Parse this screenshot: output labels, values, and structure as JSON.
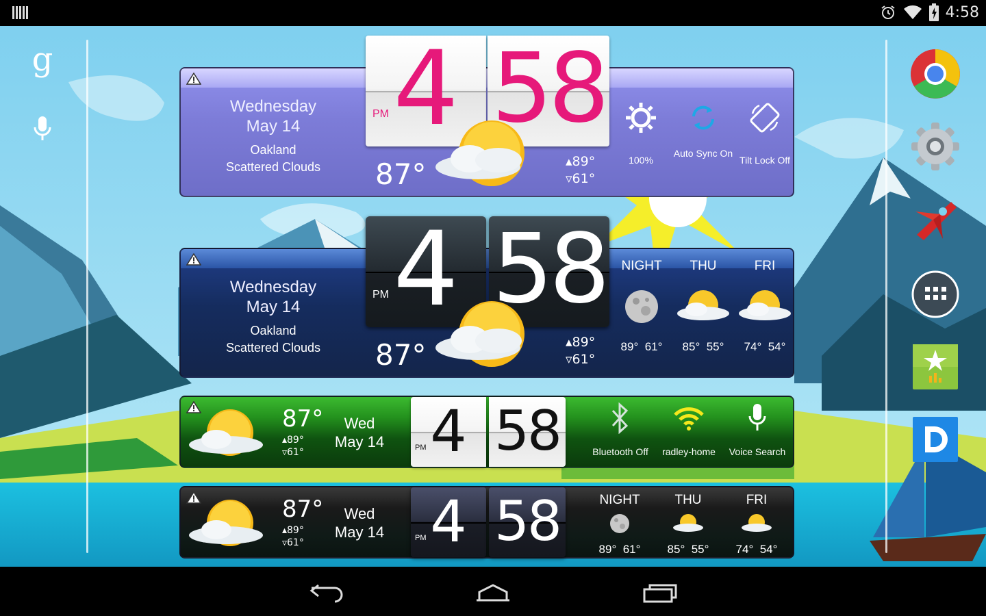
{
  "status_bar": {
    "time": "4:58"
  },
  "widgets": [
    {
      "style": "purple",
      "day": "Wednesday",
      "date": "May 14",
      "city": "Oakland",
      "condition": "Scattered Clouds",
      "hour": "4",
      "minute": "58",
      "ampm": "PM",
      "temp": "87°",
      "high": "▴89°",
      "low": "▿61°",
      "controls": [
        {
          "label": "100%",
          "icon": "brightness-icon"
        },
        {
          "label": "Auto Sync On",
          "icon": "sync-icon"
        },
        {
          "label": "Tilt Lock Off",
          "icon": "rotation-icon"
        }
      ]
    },
    {
      "style": "dark-blue",
      "day": "Wednesday",
      "date": "May 14",
      "city": "Oakland",
      "condition": "Scattered Clouds",
      "hour": "4",
      "minute": "58",
      "ampm": "PM",
      "temp": "87°",
      "high": "▴89°",
      "low": "▿61°",
      "forecast": [
        {
          "label": "NIGHT",
          "hi": "89°",
          "lo": "61°",
          "icon": "moon-icon"
        },
        {
          "label": "THU",
          "hi": "85°",
          "lo": "55°",
          "icon": "partly-cloudy-icon"
        },
        {
          "label": "FRI",
          "hi": "74°",
          "lo": "54°",
          "icon": "partly-cloudy-icon"
        }
      ]
    },
    {
      "style": "green",
      "temp": "87°",
      "high": "▴89°",
      "low": "▿61°",
      "day": "Wed",
      "date": "May 14",
      "hour": "4",
      "minute": "58",
      "ampm": "PM",
      "controls": [
        {
          "label": "Bluetooth Off",
          "icon": "bluetooth-icon"
        },
        {
          "label": "radley-home",
          "icon": "wifi-icon"
        },
        {
          "label": "Voice Search",
          "icon": "microphone-icon"
        }
      ]
    },
    {
      "style": "black",
      "temp": "87°",
      "high": "▴89°",
      "low": "▿61°",
      "day": "Wed",
      "date": "May 14",
      "hour": "4",
      "minute": "58",
      "ampm": "PM",
      "forecast": [
        {
          "label": "NIGHT",
          "hi": "89°",
          "lo": "61°",
          "icon": "moon-icon"
        },
        {
          "label": "THU",
          "hi": "85°",
          "lo": "55°",
          "icon": "partly-cloudy-icon"
        },
        {
          "label": "FRI",
          "hi": "74°",
          "lo": "54°",
          "icon": "partly-cloudy-icon"
        }
      ]
    }
  ],
  "google_search": {
    "logo": "g"
  },
  "dock": [
    "chrome-icon",
    "settings-icon",
    "plane-game-icon",
    "app-drawer-icon",
    "play-games-icon",
    "d-app-icon"
  ],
  "colors": {
    "clock_accent": "#e6197a",
    "sky": "#8fd6ef",
    "water": "#18b4d8",
    "grass": "#c8e054"
  }
}
